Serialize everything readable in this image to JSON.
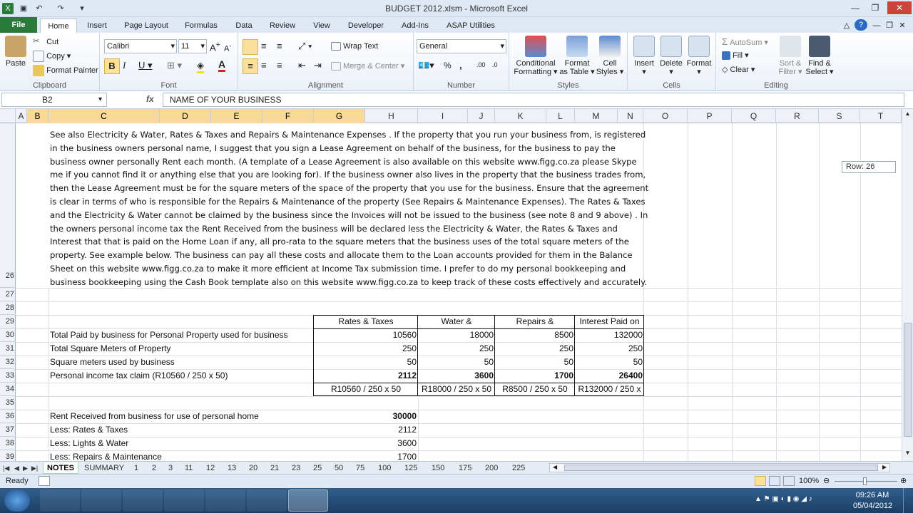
{
  "window": {
    "title": "BUDGET 2012.xlsm - Microsoft Excel"
  },
  "tabs": [
    "File",
    "Home",
    "Insert",
    "Page Layout",
    "Formulas",
    "Data",
    "Review",
    "View",
    "Developer",
    "Add-Ins",
    "ASAP Utilities"
  ],
  "ribbon": {
    "clipboard": {
      "label": "Clipboard",
      "paste": "Paste",
      "cut": "Cut",
      "copy": "Copy",
      "format_painter": "Format Painter"
    },
    "font": {
      "label": "Font",
      "name": "Calibri",
      "size": "11"
    },
    "alignment": {
      "label": "Alignment",
      "wrap": "Wrap Text",
      "merge": "Merge & Center"
    },
    "number": {
      "label": "Number",
      "format": "General"
    },
    "styles": {
      "label": "Styles",
      "cond1": "Conditional",
      "cond2": "Formatting",
      "fmt1": "Format",
      "fmt2": "as Table",
      "cell1": "Cell",
      "cell2": "Styles"
    },
    "cells": {
      "label": "Cells",
      "insert": "Insert",
      "delete": "Delete",
      "format": "Format"
    },
    "editing": {
      "label": "Editing",
      "autosum": "AutoSum",
      "fill": "Fill",
      "clear": "Clear",
      "sort1": "Sort &",
      "sort2": "Filter",
      "find1": "Find &",
      "find2": "Select"
    }
  },
  "formula_bar": {
    "name_box": "B2",
    "fx": "fx",
    "content": "NAME OF YOUR BUSINESS"
  },
  "columns": [
    "A",
    "B",
    "C",
    "D",
    "E",
    "F",
    "G",
    "H",
    "I",
    "J",
    "K",
    "L",
    "M",
    "N",
    "O",
    "P",
    "Q",
    "R",
    "S",
    "T"
  ],
  "rows": [
    "26",
    "27",
    "28",
    "29",
    "30",
    "31",
    "32",
    "33",
    "34",
    "35",
    "36",
    "37",
    "38",
    "39"
  ],
  "paragraph": "See also Electricity & Water, Rates & Taxes and Repairs & Maintenance Expenses .  If the property that you run your business from, is registered in the business owners personal name, I suggest that you sign a Lease Agreement on behalf of the business, for the business to pay the business owner personally Rent each month. (A template of a Lease Agreement is also available on this website www.figg.co.za please Skype me if you cannot find it or anything else that you are looking for). If the business owner also lives in the property that the business trades from, then the Lease Agreement must be for the square meters of the space of the property that you use for the business. Ensure that the agreement is clear in terms of who is responsible for the Repairs & Maintenance of the property (See Repairs & Maintenance Expenses).  The Rates & Taxes and the Electricity & Water cannot be claimed by the business since the Invoices will not be issued to the business (see note 8 and 9 above) .  In the owners personal income tax the Rent Received from the business will be declared less the Electricity & Water, the Rates & Taxes and Interest that that is paid on the Home Loan if any, all pro-rata to the square meters that the business uses of the total square meters of the property.  See example below.  The business can pay all these costs and allocate them to the Loan accounts provided for them in the Balance Sheet on this website www.figg.co.za to make it more efficient at Income Tax submission time.  I prefer to do my personal bookkeeping and business bookkeeping using the Cash Book template also on this website www.figg.co.za to keep track of these costs effectively and accurately.",
  "table": {
    "headers": [
      "Rates & Taxes",
      "Water &",
      "Repairs &",
      "Interest Paid on"
    ],
    "rows": [
      {
        "label": "Total Paid by business for Personal Property used for business",
        "values": [
          "10560",
          "18000",
          "8500",
          "132000"
        ]
      },
      {
        "label": "Total Square Meters of Property",
        "values": [
          "250",
          "250",
          "250",
          "250"
        ]
      },
      {
        "label": "Square meters used by business",
        "values": [
          "50",
          "50",
          "50",
          "50"
        ]
      },
      {
        "label": "Personal income tax claim (R10560 / 250 x 50)",
        "values": [
          "2112",
          "3600",
          "1700",
          "26400"
        ]
      }
    ],
    "formulas": [
      "R10560 / 250 x 50",
      "R18000 / 250 x 50",
      "R8500 / 250 x 50",
      "R132000 / 250 x"
    ]
  },
  "rent": [
    {
      "label": "Rent Received from business for use of personal home",
      "value": "30000"
    },
    {
      "label": "Less:  Rates & Taxes",
      "value": "2112"
    },
    {
      "label": "Less:  Lights & Water",
      "value": "3600"
    },
    {
      "label": "Less:  Repairs & Maintenance",
      "value": "1700"
    }
  ],
  "row_tip": "Row: 26",
  "sheets": [
    "NOTES",
    "SUMMARY",
    "1",
    "2",
    "3",
    "11",
    "12",
    "13",
    "20",
    "21",
    "23",
    "25",
    "50",
    "75",
    "100",
    "125",
    "150",
    "175",
    "200",
    "225"
  ],
  "status": {
    "ready": "Ready",
    "zoom": "100%"
  },
  "clock": {
    "time": "09:26 AM",
    "date": "05/04/2012"
  }
}
